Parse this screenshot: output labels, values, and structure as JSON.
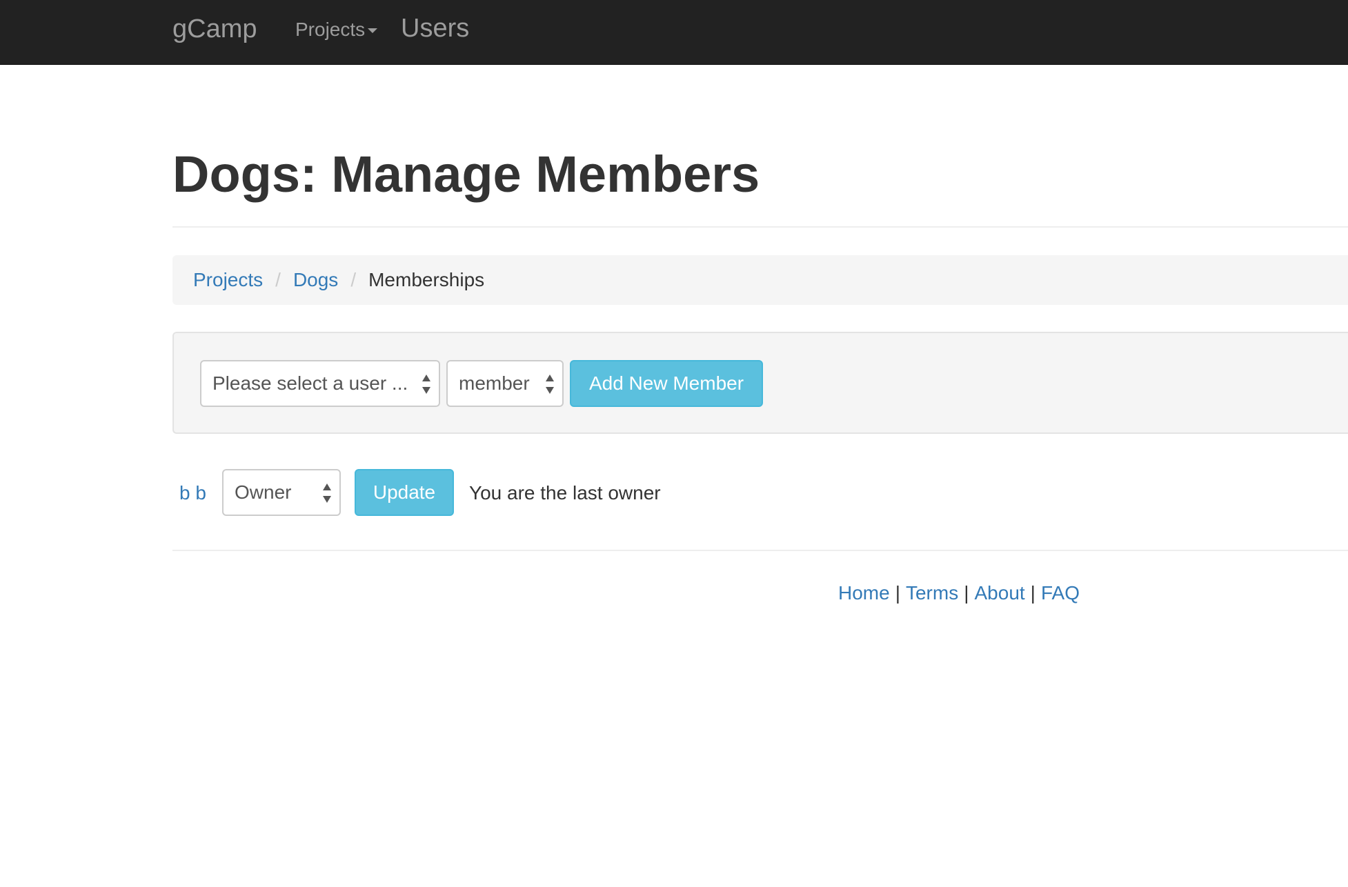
{
  "navbar": {
    "brand": "gCamp",
    "projects_label": "Projects",
    "users_label": "Users"
  },
  "page": {
    "title": "Dogs: Manage Members"
  },
  "breadcrumb": {
    "items": [
      {
        "label": "Projects"
      },
      {
        "label": "Dogs"
      },
      {
        "label": "Memberships"
      }
    ],
    "separator": "/"
  },
  "add_member_form": {
    "user_select_value": "Please select a user ...",
    "role_select_value": "member",
    "submit_label": "Add New Member"
  },
  "memberships": [
    {
      "name": "b b",
      "role": "Owner",
      "update_label": "Update",
      "note": "You are the last owner"
    }
  ],
  "footer": {
    "links": [
      "Home",
      "Terms",
      "About",
      "FAQ"
    ],
    "separator": "|"
  },
  "colors": {
    "navbar_bg": "#222222",
    "link": "#337ab7",
    "info_button": "#5bc0de",
    "well_bg": "#f5f5f5"
  }
}
